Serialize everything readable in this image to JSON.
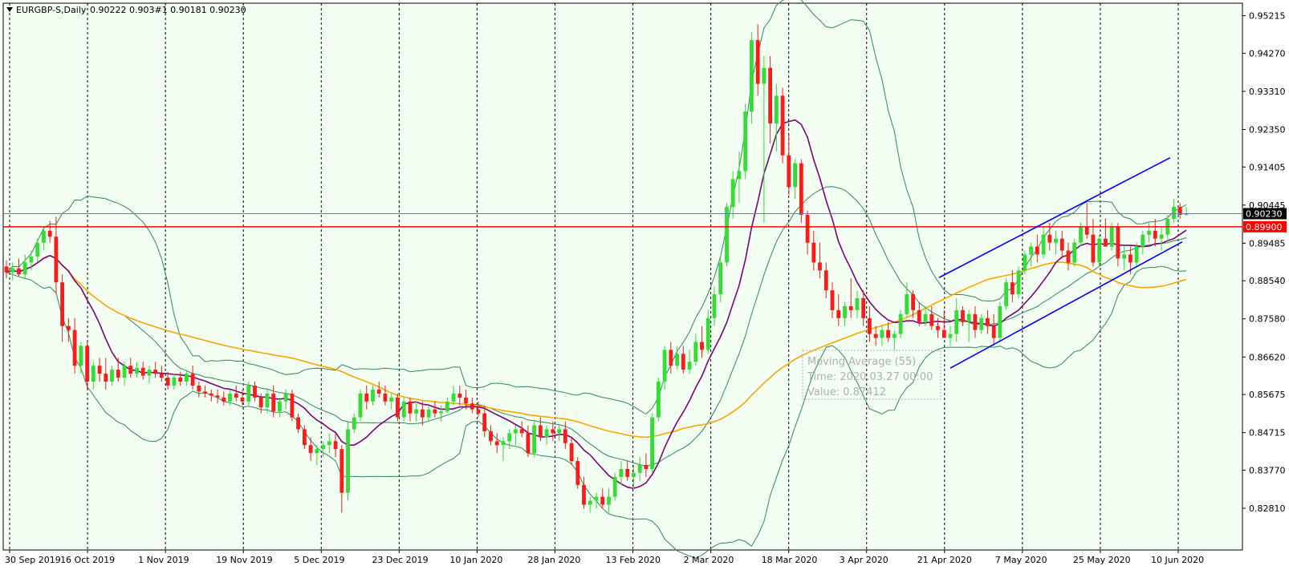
{
  "header": {
    "symbol_label": "EURGBP-S,Daily",
    "ohlc_label": "0.90222 0.903#1 0.90181 0.90230"
  },
  "colors": {
    "background": "#f2fff2",
    "grid": "#000000",
    "bull_candle": "#33dd33",
    "bear_candle": "#ff1a1a",
    "ma_purple": "#800080",
    "ma_orange": "#ffa500",
    "bollinger": "#2e8b57",
    "channel": "#0000ff",
    "resistance": "#ff0000",
    "price_line": "#708090"
  },
  "tooltip": {
    "line1": "Moving Average (55)",
    "line2": "Time: 2020.03.27 00:00",
    "line3": "Value: 0.87412"
  },
  "price_badges": {
    "current": "0.90230",
    "resistance": "0.89900"
  },
  "chart_data": {
    "type": "candlestick",
    "ylim": [
      0.8176,
      0.9553
    ],
    "y_ticks": [
      "0.95215",
      "0.94270",
      "0.93310",
      "0.92350",
      "0.91405",
      "0.90445",
      "0.89485",
      "0.88540",
      "0.87580",
      "0.86620",
      "0.85675",
      "0.84715",
      "0.83770",
      "0.82810"
    ],
    "x_ticks": [
      "30 Sep 2019",
      "16 Oct 2019",
      "1 Nov 2019",
      "19 Nov 2019",
      "5 Dec 2019",
      "23 Dec 2019",
      "10 Jan 2020",
      "28 Jan 2020",
      "13 Feb 2020",
      "2 Mar 2020",
      "18 Mar 2020",
      "3 Apr 2020",
      "21 Apr 2020",
      "7 May 2020",
      "25 May 2020",
      "10 Jun 2020"
    ],
    "resistance_level": 0.899,
    "current_price": 0.9023,
    "channel_upper": [
      [
        0.8862,
        0.9164
      ]
    ],
    "channel_lower": [
      [
        0.8634,
        0.8952
      ]
    ],
    "candles": [
      {
        "o": 0.889,
        "h": 0.8905,
        "l": 0.886,
        "c": 0.8875
      },
      {
        "o": 0.8875,
        "h": 0.89,
        "l": 0.8855,
        "c": 0.8885
      },
      {
        "o": 0.8885,
        "h": 0.891,
        "l": 0.8865,
        "c": 0.887
      },
      {
        "o": 0.887,
        "h": 0.892,
        "l": 0.886,
        "c": 0.89
      },
      {
        "o": 0.89,
        "h": 0.893,
        "l": 0.888,
        "c": 0.8915
      },
      {
        "o": 0.8915,
        "h": 0.896,
        "l": 0.89,
        "c": 0.895
      },
      {
        "o": 0.895,
        "h": 0.899,
        "l": 0.893,
        "c": 0.898
      },
      {
        "o": 0.898,
        "h": 0.9005,
        "l": 0.895,
        "c": 0.8965
      },
      {
        "o": 0.8965,
        "h": 0.9015,
        "l": 0.882,
        "c": 0.885
      },
      {
        "o": 0.885,
        "h": 0.887,
        "l": 0.87,
        "c": 0.874
      },
      {
        "o": 0.874,
        "h": 0.876,
        "l": 0.87,
        "c": 0.873
      },
      {
        "o": 0.873,
        "h": 0.876,
        "l": 0.862,
        "c": 0.864
      },
      {
        "o": 0.864,
        "h": 0.87,
        "l": 0.862,
        "c": 0.869
      },
      {
        "o": 0.869,
        "h": 0.87,
        "l": 0.858,
        "c": 0.86
      },
      {
        "o": 0.86,
        "h": 0.865,
        "l": 0.858,
        "c": 0.864
      },
      {
        "o": 0.864,
        "h": 0.866,
        "l": 0.86,
        "c": 0.862
      },
      {
        "o": 0.862,
        "h": 0.866,
        "l": 0.858,
        "c": 0.86
      },
      {
        "o": 0.86,
        "h": 0.864,
        "l": 0.859,
        "c": 0.863
      },
      {
        "o": 0.863,
        "h": 0.866,
        "l": 0.86,
        "c": 0.861
      },
      {
        "o": 0.861,
        "h": 0.865,
        "l": 0.859,
        "c": 0.864
      },
      {
        "o": 0.864,
        "h": 0.866,
        "l": 0.861,
        "c": 0.862
      },
      {
        "o": 0.862,
        "h": 0.865,
        "l": 0.861,
        "c": 0.8635
      },
      {
        "o": 0.8635,
        "h": 0.865,
        "l": 0.8605,
        "c": 0.8615
      },
      {
        "o": 0.8615,
        "h": 0.864,
        "l": 0.8595,
        "c": 0.863
      },
      {
        "o": 0.863,
        "h": 0.865,
        "l": 0.861,
        "c": 0.862
      },
      {
        "o": 0.862,
        "h": 0.864,
        "l": 0.86,
        "c": 0.861
      },
      {
        "o": 0.861,
        "h": 0.8625,
        "l": 0.858,
        "c": 0.859
      },
      {
        "o": 0.859,
        "h": 0.862,
        "l": 0.858,
        "c": 0.861
      },
      {
        "o": 0.861,
        "h": 0.8625,
        "l": 0.859,
        "c": 0.86
      },
      {
        "o": 0.86,
        "h": 0.863,
        "l": 0.859,
        "c": 0.862
      },
      {
        "o": 0.862,
        "h": 0.864,
        "l": 0.858,
        "c": 0.859
      },
      {
        "o": 0.859,
        "h": 0.86,
        "l": 0.856,
        "c": 0.8575
      },
      {
        "o": 0.8575,
        "h": 0.859,
        "l": 0.856,
        "c": 0.857
      },
      {
        "o": 0.857,
        "h": 0.858,
        "l": 0.855,
        "c": 0.8565
      },
      {
        "o": 0.8565,
        "h": 0.858,
        "l": 0.8545,
        "c": 0.856
      },
      {
        "o": 0.856,
        "h": 0.8575,
        "l": 0.854,
        "c": 0.855
      },
      {
        "o": 0.855,
        "h": 0.858,
        "l": 0.854,
        "c": 0.857
      },
      {
        "o": 0.857,
        "h": 0.859,
        "l": 0.855,
        "c": 0.856
      },
      {
        "o": 0.856,
        "h": 0.858,
        "l": 0.854,
        "c": 0.855
      },
      {
        "o": 0.855,
        "h": 0.86,
        "l": 0.854,
        "c": 0.859
      },
      {
        "o": 0.859,
        "h": 0.86,
        "l": 0.855,
        "c": 0.856
      },
      {
        "o": 0.856,
        "h": 0.857,
        "l": 0.852,
        "c": 0.8535
      },
      {
        "o": 0.8535,
        "h": 0.858,
        "l": 0.852,
        "c": 0.857
      },
      {
        "o": 0.857,
        "h": 0.859,
        "l": 0.851,
        "c": 0.8525
      },
      {
        "o": 0.8525,
        "h": 0.856,
        "l": 0.851,
        "c": 0.855
      },
      {
        "o": 0.855,
        "h": 0.858,
        "l": 0.853,
        "c": 0.857
      },
      {
        "o": 0.857,
        "h": 0.858,
        "l": 0.85,
        "c": 0.851
      },
      {
        "o": 0.851,
        "h": 0.852,
        "l": 0.847,
        "c": 0.848
      },
      {
        "o": 0.848,
        "h": 0.849,
        "l": 0.843,
        "c": 0.844
      },
      {
        "o": 0.844,
        "h": 0.846,
        "l": 0.84,
        "c": 0.842
      },
      {
        "o": 0.842,
        "h": 0.844,
        "l": 0.839,
        "c": 0.843
      },
      {
        "o": 0.843,
        "h": 0.845,
        "l": 0.841,
        "c": 0.844
      },
      {
        "o": 0.844,
        "h": 0.847,
        "l": 0.842,
        "c": 0.845
      },
      {
        "o": 0.845,
        "h": 0.847,
        "l": 0.841,
        "c": 0.843
      },
      {
        "o": 0.843,
        "h": 0.844,
        "l": 0.827,
        "c": 0.832
      },
      {
        "o": 0.832,
        "h": 0.85,
        "l": 0.83,
        "c": 0.848
      },
      {
        "o": 0.848,
        "h": 0.852,
        "l": 0.847,
        "c": 0.851
      },
      {
        "o": 0.851,
        "h": 0.858,
        "l": 0.85,
        "c": 0.857
      },
      {
        "o": 0.857,
        "h": 0.859,
        "l": 0.853,
        "c": 0.855
      },
      {
        "o": 0.855,
        "h": 0.859,
        "l": 0.854,
        "c": 0.858
      },
      {
        "o": 0.858,
        "h": 0.86,
        "l": 0.856,
        "c": 0.857
      },
      {
        "o": 0.857,
        "h": 0.859,
        "l": 0.854,
        "c": 0.855
      },
      {
        "o": 0.855,
        "h": 0.857,
        "l": 0.853,
        "c": 0.856
      },
      {
        "o": 0.856,
        "h": 0.857,
        "l": 0.85,
        "c": 0.851
      },
      {
        "o": 0.851,
        "h": 0.856,
        "l": 0.85,
        "c": 0.855
      },
      {
        "o": 0.855,
        "h": 0.856,
        "l": 0.85,
        "c": 0.852
      },
      {
        "o": 0.852,
        "h": 0.855,
        "l": 0.85,
        "c": 0.853
      },
      {
        "o": 0.853,
        "h": 0.855,
        "l": 0.849,
        "c": 0.851
      },
      {
        "o": 0.851,
        "h": 0.854,
        "l": 0.85,
        "c": 0.853
      },
      {
        "o": 0.853,
        "h": 0.855,
        "l": 0.851,
        "c": 0.852
      },
      {
        "o": 0.852,
        "h": 0.854,
        "l": 0.85,
        "c": 0.8525
      },
      {
        "o": 0.8525,
        "h": 0.856,
        "l": 0.852,
        "c": 0.855
      },
      {
        "o": 0.855,
        "h": 0.859,
        "l": 0.854,
        "c": 0.857
      },
      {
        "o": 0.857,
        "h": 0.859,
        "l": 0.854,
        "c": 0.856
      },
      {
        "o": 0.856,
        "h": 0.858,
        "l": 0.853,
        "c": 0.8545
      },
      {
        "o": 0.8545,
        "h": 0.856,
        "l": 0.852,
        "c": 0.853
      },
      {
        "o": 0.853,
        "h": 0.855,
        "l": 0.851,
        "c": 0.852
      },
      {
        "o": 0.852,
        "h": 0.854,
        "l": 0.846,
        "c": 0.8475
      },
      {
        "o": 0.8475,
        "h": 0.849,
        "l": 0.844,
        "c": 0.845
      },
      {
        "o": 0.845,
        "h": 0.847,
        "l": 0.842,
        "c": 0.844
      },
      {
        "o": 0.844,
        "h": 0.846,
        "l": 0.84,
        "c": 0.845
      },
      {
        "o": 0.845,
        "h": 0.848,
        "l": 0.843,
        "c": 0.847
      },
      {
        "o": 0.847,
        "h": 0.849,
        "l": 0.844,
        "c": 0.848
      },
      {
        "o": 0.848,
        "h": 0.85,
        "l": 0.846,
        "c": 0.847
      },
      {
        "o": 0.847,
        "h": 0.849,
        "l": 0.841,
        "c": 0.842
      },
      {
        "o": 0.842,
        "h": 0.85,
        "l": 0.841,
        "c": 0.849
      },
      {
        "o": 0.849,
        "h": 0.851,
        "l": 0.845,
        "c": 0.846
      },
      {
        "o": 0.846,
        "h": 0.849,
        "l": 0.844,
        "c": 0.848
      },
      {
        "o": 0.848,
        "h": 0.85,
        "l": 0.845,
        "c": 0.847
      },
      {
        "o": 0.847,
        "h": 0.849,
        "l": 0.845,
        "c": 0.848
      },
      {
        "o": 0.848,
        "h": 0.85,
        "l": 0.843,
        "c": 0.8445
      },
      {
        "o": 0.8445,
        "h": 0.846,
        "l": 0.839,
        "c": 0.84
      },
      {
        "o": 0.84,
        "h": 0.841,
        "l": 0.833,
        "c": 0.834
      },
      {
        "o": 0.834,
        "h": 0.836,
        "l": 0.828,
        "c": 0.829
      },
      {
        "o": 0.829,
        "h": 0.831,
        "l": 0.827,
        "c": 0.83
      },
      {
        "o": 0.83,
        "h": 0.832,
        "l": 0.828,
        "c": 0.831
      },
      {
        "o": 0.831,
        "h": 0.833,
        "l": 0.828,
        "c": 0.829
      },
      {
        "o": 0.829,
        "h": 0.833,
        "l": 0.827,
        "c": 0.831
      },
      {
        "o": 0.831,
        "h": 0.837,
        "l": 0.83,
        "c": 0.836
      },
      {
        "o": 0.836,
        "h": 0.84,
        "l": 0.834,
        "c": 0.838
      },
      {
        "o": 0.838,
        "h": 0.84,
        "l": 0.835,
        "c": 0.836
      },
      {
        "o": 0.836,
        "h": 0.839,
        "l": 0.833,
        "c": 0.837
      },
      {
        "o": 0.837,
        "h": 0.841,
        "l": 0.835,
        "c": 0.839
      },
      {
        "o": 0.839,
        "h": 0.842,
        "l": 0.836,
        "c": 0.838
      },
      {
        "o": 0.838,
        "h": 0.852,
        "l": 0.837,
        "c": 0.851
      },
      {
        "o": 0.851,
        "h": 0.861,
        "l": 0.85,
        "c": 0.86
      },
      {
        "o": 0.86,
        "h": 0.869,
        "l": 0.858,
        "c": 0.868
      },
      {
        "o": 0.868,
        "h": 0.87,
        "l": 0.862,
        "c": 0.864
      },
      {
        "o": 0.864,
        "h": 0.869,
        "l": 0.863,
        "c": 0.867
      },
      {
        "o": 0.867,
        "h": 0.869,
        "l": 0.862,
        "c": 0.863
      },
      {
        "o": 0.863,
        "h": 0.868,
        "l": 0.862,
        "c": 0.865
      },
      {
        "o": 0.865,
        "h": 0.872,
        "l": 0.864,
        "c": 0.87
      },
      {
        "o": 0.87,
        "h": 0.874,
        "l": 0.866,
        "c": 0.868
      },
      {
        "o": 0.868,
        "h": 0.878,
        "l": 0.867,
        "c": 0.876
      },
      {
        "o": 0.876,
        "h": 0.884,
        "l": 0.874,
        "c": 0.882
      },
      {
        "o": 0.882,
        "h": 0.892,
        "l": 0.88,
        "c": 0.89
      },
      {
        "o": 0.89,
        "h": 0.905,
        "l": 0.889,
        "c": 0.904
      },
      {
        "o": 0.904,
        "h": 0.913,
        "l": 0.901,
        "c": 0.911
      },
      {
        "o": 0.911,
        "h": 0.918,
        "l": 0.905,
        "c": 0.913
      },
      {
        "o": 0.913,
        "h": 0.93,
        "l": 0.911,
        "c": 0.928
      },
      {
        "o": 0.928,
        "h": 0.948,
        "l": 0.925,
        "c": 0.946
      },
      {
        "o": 0.946,
        "h": 0.95,
        "l": 0.932,
        "c": 0.935
      },
      {
        "o": 0.935,
        "h": 0.942,
        "l": 0.9,
        "c": 0.939
      },
      {
        "o": 0.939,
        "h": 0.942,
        "l": 0.92,
        "c": 0.925
      },
      {
        "o": 0.925,
        "h": 0.935,
        "l": 0.918,
        "c": 0.932
      },
      {
        "o": 0.932,
        "h": 0.934,
        "l": 0.915,
        "c": 0.917
      },
      {
        "o": 0.917,
        "h": 0.922,
        "l": 0.907,
        "c": 0.909
      },
      {
        "o": 0.909,
        "h": 0.916,
        "l": 0.906,
        "c": 0.915
      },
      {
        "o": 0.915,
        "h": 0.916,
        "l": 0.9,
        "c": 0.902
      },
      {
        "o": 0.902,
        "h": 0.903,
        "l": 0.892,
        "c": 0.895
      },
      {
        "o": 0.895,
        "h": 0.898,
        "l": 0.888,
        "c": 0.89
      },
      {
        "o": 0.89,
        "h": 0.895,
        "l": 0.886,
        "c": 0.888
      },
      {
        "o": 0.888,
        "h": 0.89,
        "l": 0.881,
        "c": 0.883
      },
      {
        "o": 0.883,
        "h": 0.885,
        "l": 0.876,
        "c": 0.878
      },
      {
        "o": 0.878,
        "h": 0.882,
        "l": 0.874,
        "c": 0.876
      },
      {
        "o": 0.876,
        "h": 0.88,
        "l": 0.874,
        "c": 0.879
      },
      {
        "o": 0.879,
        "h": 0.886,
        "l": 0.876,
        "c": 0.878
      },
      {
        "o": 0.878,
        "h": 0.883,
        "l": 0.876,
        "c": 0.881
      },
      {
        "o": 0.881,
        "h": 0.883,
        "l": 0.874,
        "c": 0.876
      },
      {
        "o": 0.876,
        "h": 0.879,
        "l": 0.87,
        "c": 0.872
      },
      {
        "o": 0.872,
        "h": 0.874,
        "l": 0.869,
        "c": 0.871
      },
      {
        "o": 0.871,
        "h": 0.874,
        "l": 0.869,
        "c": 0.873
      },
      {
        "o": 0.873,
        "h": 0.875,
        "l": 0.87,
        "c": 0.871
      },
      {
        "o": 0.871,
        "h": 0.873,
        "l": 0.868,
        "c": 0.872
      },
      {
        "o": 0.872,
        "h": 0.878,
        "l": 0.871,
        "c": 0.877
      },
      {
        "o": 0.877,
        "h": 0.885,
        "l": 0.876,
        "c": 0.882
      },
      {
        "o": 0.882,
        "h": 0.883,
        "l": 0.876,
        "c": 0.878
      },
      {
        "o": 0.878,
        "h": 0.88,
        "l": 0.874,
        "c": 0.875
      },
      {
        "o": 0.875,
        "h": 0.879,
        "l": 0.874,
        "c": 0.877
      },
      {
        "o": 0.877,
        "h": 0.879,
        "l": 0.873,
        "c": 0.874
      },
      {
        "o": 0.874,
        "h": 0.876,
        "l": 0.871,
        "c": 0.873
      },
      {
        "o": 0.873,
        "h": 0.878,
        "l": 0.872,
        "c": 0.871
      },
      {
        "o": 0.871,
        "h": 0.874,
        "l": 0.869,
        "c": 0.872
      },
      {
        "o": 0.872,
        "h": 0.881,
        "l": 0.87,
        "c": 0.878
      },
      {
        "o": 0.878,
        "h": 0.879,
        "l": 0.874,
        "c": 0.875
      },
      {
        "o": 0.875,
        "h": 0.878,
        "l": 0.87,
        "c": 0.877
      },
      {
        "o": 0.877,
        "h": 0.879,
        "l": 0.871,
        "c": 0.873
      },
      {
        "o": 0.873,
        "h": 0.877,
        "l": 0.872,
        "c": 0.876
      },
      {
        "o": 0.876,
        "h": 0.878,
        "l": 0.872,
        "c": 0.874
      },
      {
        "o": 0.874,
        "h": 0.877,
        "l": 0.869,
        "c": 0.871
      },
      {
        "o": 0.871,
        "h": 0.88,
        "l": 0.87,
        "c": 0.879
      },
      {
        "o": 0.879,
        "h": 0.886,
        "l": 0.878,
        "c": 0.885
      },
      {
        "o": 0.885,
        "h": 0.888,
        "l": 0.88,
        "c": 0.882
      },
      {
        "o": 0.882,
        "h": 0.889,
        "l": 0.881,
        "c": 0.888
      },
      {
        "o": 0.888,
        "h": 0.893,
        "l": 0.887,
        "c": 0.892
      },
      {
        "o": 0.892,
        "h": 0.895,
        "l": 0.889,
        "c": 0.894
      },
      {
        "o": 0.894,
        "h": 0.897,
        "l": 0.89,
        "c": 0.892
      },
      {
        "o": 0.892,
        "h": 0.899,
        "l": 0.891,
        "c": 0.897
      },
      {
        "o": 0.897,
        "h": 0.9,
        "l": 0.893,
        "c": 0.895
      },
      {
        "o": 0.895,
        "h": 0.898,
        "l": 0.892,
        "c": 0.896
      },
      {
        "o": 0.896,
        "h": 0.898,
        "l": 0.891,
        "c": 0.893
      },
      {
        "o": 0.893,
        "h": 0.895,
        "l": 0.888,
        "c": 0.89
      },
      {
        "o": 0.89,
        "h": 0.896,
        "l": 0.889,
        "c": 0.895
      },
      {
        "o": 0.895,
        "h": 0.9,
        "l": 0.894,
        "c": 0.899
      },
      {
        "o": 0.899,
        "h": 0.905,
        "l": 0.896,
        "c": 0.897
      },
      {
        "o": 0.897,
        "h": 0.901,
        "l": 0.889,
        "c": 0.89
      },
      {
        "o": 0.89,
        "h": 0.897,
        "l": 0.889,
        "c": 0.896
      },
      {
        "o": 0.896,
        "h": 0.901,
        "l": 0.894,
        "c": 0.894
      },
      {
        "o": 0.894,
        "h": 0.9,
        "l": 0.893,
        "c": 0.899
      },
      {
        "o": 0.899,
        "h": 0.9,
        "l": 0.889,
        "c": 0.891
      },
      {
        "o": 0.891,
        "h": 0.894,
        "l": 0.888,
        "c": 0.892
      },
      {
        "o": 0.892,
        "h": 0.894,
        "l": 0.887,
        "c": 0.89
      },
      {
        "o": 0.89,
        "h": 0.895,
        "l": 0.889,
        "c": 0.894
      },
      {
        "o": 0.894,
        "h": 0.898,
        "l": 0.892,
        "c": 0.897
      },
      {
        "o": 0.897,
        "h": 0.9,
        "l": 0.895,
        "c": 0.898
      },
      {
        "o": 0.898,
        "h": 0.901,
        "l": 0.894,
        "c": 0.896
      },
      {
        "o": 0.896,
        "h": 0.899,
        "l": 0.893,
        "c": 0.897
      },
      {
        "o": 0.897,
        "h": 0.902,
        "l": 0.895,
        "c": 0.901
      },
      {
        "o": 0.901,
        "h": 0.906,
        "l": 0.9,
        "c": 0.904
      },
      {
        "o": 0.904,
        "h": 0.905,
        "l": 0.901,
        "c": 0.902
      },
      {
        "o": 0.902,
        "h": 0.904,
        "l": 0.9018,
        "c": 0.9023
      }
    ]
  }
}
